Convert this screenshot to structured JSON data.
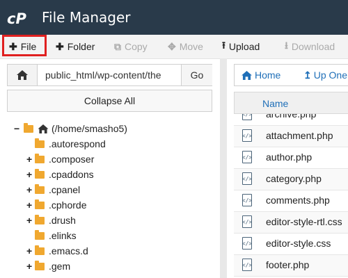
{
  "app": {
    "title": "File Manager",
    "logo": "cP"
  },
  "toolbar": {
    "file": {
      "icon": "plus-icon",
      "label": "File"
    },
    "folder": {
      "icon": "plus-icon",
      "label": "Folder"
    },
    "copy": {
      "icon": "copy-icon",
      "label": "Copy"
    },
    "move": {
      "icon": "move-icon",
      "label": "Move"
    },
    "upload": {
      "icon": "upload-icon",
      "label": "Upload"
    },
    "download": {
      "icon": "download-icon",
      "label": "Download"
    }
  },
  "path": {
    "value": "public_html/wp-content/the",
    "go_label": "Go"
  },
  "collapse_label": "Collapse All",
  "tree": {
    "root": "(/home/smasho5)",
    "items": [
      {
        "toggle": "",
        "label": ".autorespond"
      },
      {
        "toggle": "+",
        "label": ".composer"
      },
      {
        "toggle": "+",
        "label": ".cpaddons"
      },
      {
        "toggle": "+",
        "label": ".cpanel"
      },
      {
        "toggle": "+",
        "label": ".cphorde"
      },
      {
        "toggle": "+",
        "label": ".drush"
      },
      {
        "toggle": "",
        "label": ".elinks"
      },
      {
        "toggle": "+",
        "label": ".emacs.d"
      },
      {
        "toggle": "+",
        "label": ".gem"
      }
    ]
  },
  "right_nav": {
    "home": "Home",
    "up_one": "Up One"
  },
  "file_list": {
    "column": "Name",
    "files": [
      "archive.php",
      "attachment.php",
      "author.php",
      "category.php",
      "comments.php",
      "editor-style-rtl.css",
      "editor-style.css",
      "footer.php"
    ]
  },
  "colors": {
    "header": "#293a4a",
    "accent": "#1f6fb8",
    "folder": "#f0a830",
    "highlight": "#e02020"
  }
}
